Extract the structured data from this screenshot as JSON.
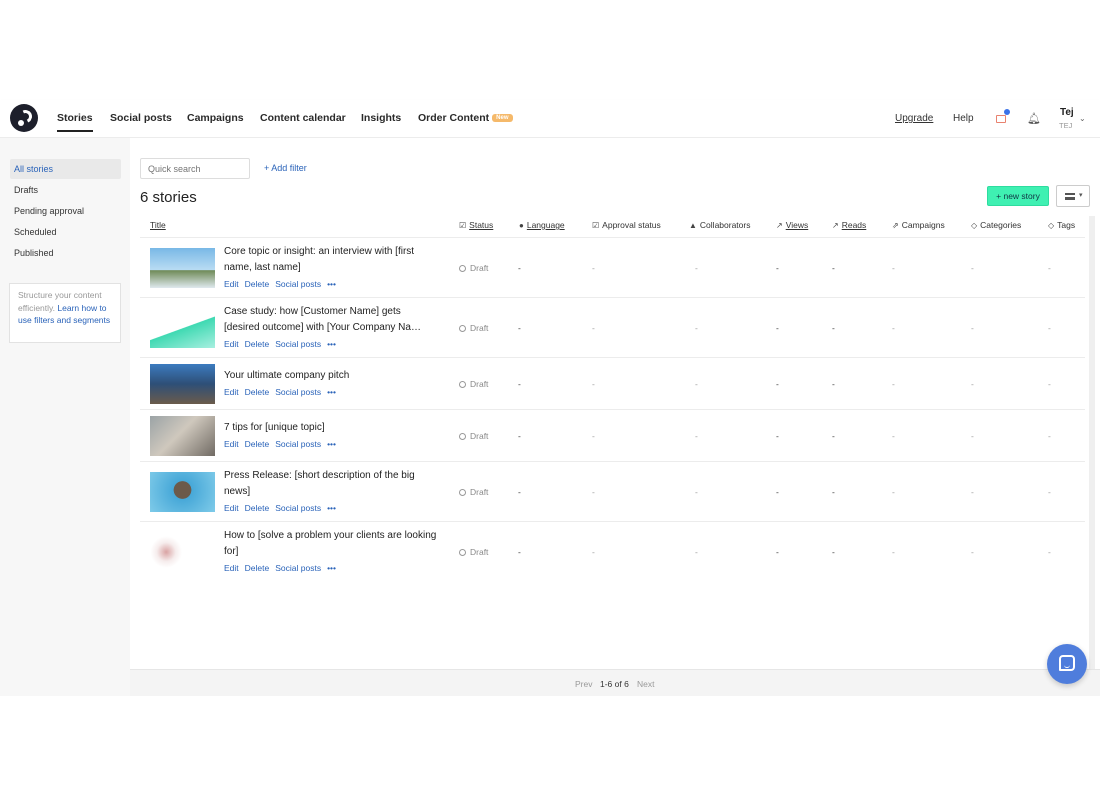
{
  "nav": {
    "items": [
      "Stories",
      "Social posts",
      "Campaigns",
      "Content calendar",
      "Insights",
      "Order Content"
    ],
    "order_badge": "New",
    "upgrade": "Upgrade",
    "help": "Help",
    "user_name": "Tej",
    "user_sub": "TEJ",
    "icons": [
      "logo-icon",
      "gift-icon",
      "bell-icon",
      "chevron-down-icon"
    ]
  },
  "sidebar": {
    "items": [
      "All stories",
      "Drafts",
      "Pending approval",
      "Scheduled",
      "Published"
    ],
    "tip_text": "Structure your content efficiently.",
    "tip_link": "Learn how to use filters and segments"
  },
  "toolbar": {
    "search_placeholder": "Quick search",
    "add_filter": "+ Add filter",
    "count": "6 stories",
    "new_story": "+ new story"
  },
  "table": {
    "columns": [
      "Title",
      "Status",
      "Language",
      "Approval status",
      "Collaborators",
      "Views",
      "Reads",
      "Campaigns",
      "Categories",
      "Tags"
    ],
    "actions": [
      "Edit",
      "Delete",
      "Social posts",
      "•••"
    ],
    "rows": [
      {
        "title": "Core topic or insight: an interview with [first name, last name]",
        "status": "Draft",
        "language": "-",
        "approval": "-",
        "collaborators": "-",
        "views": "-",
        "reads": "-",
        "campaigns": "-",
        "categories": "-",
        "tags": "-"
      },
      {
        "title": "Case study: how [Customer Name] gets [desired outcome] with [Your Company Na…",
        "status": "Draft",
        "language": "-",
        "approval": "-",
        "collaborators": "-",
        "views": "-",
        "reads": "-",
        "campaigns": "-",
        "categories": "-",
        "tags": "-"
      },
      {
        "title": "Your ultimate company pitch",
        "status": "Draft",
        "language": "-",
        "approval": "-",
        "collaborators": "-",
        "views": "-",
        "reads": "-",
        "campaigns": "-",
        "categories": "-",
        "tags": "-"
      },
      {
        "title": "7 tips for [unique topic]",
        "status": "Draft",
        "language": "-",
        "approval": "-",
        "collaborators": "-",
        "views": "-",
        "reads": "-",
        "campaigns": "-",
        "categories": "-",
        "tags": "-"
      },
      {
        "title": "Press Release: [short description of the big news]",
        "status": "Draft",
        "language": "-",
        "approval": "-",
        "collaborators": "-",
        "views": "-",
        "reads": "-",
        "campaigns": "-",
        "categories": "-",
        "tags": "-"
      },
      {
        "title": "How to [solve a problem your clients are looking for]",
        "status": "Draft",
        "language": "-",
        "approval": "-",
        "collaborators": "-",
        "views": "-",
        "reads": "-",
        "campaigns": "-",
        "categories": "-",
        "tags": "-"
      }
    ]
  },
  "pagination": {
    "prev": "Prev",
    "range": "1-6 of 6",
    "next": "Next"
  },
  "colors": {
    "accent": "#2a63b9",
    "new_story": "#3ff0b2",
    "badge": "#f5b96a",
    "chat": "#4f7ddc"
  }
}
